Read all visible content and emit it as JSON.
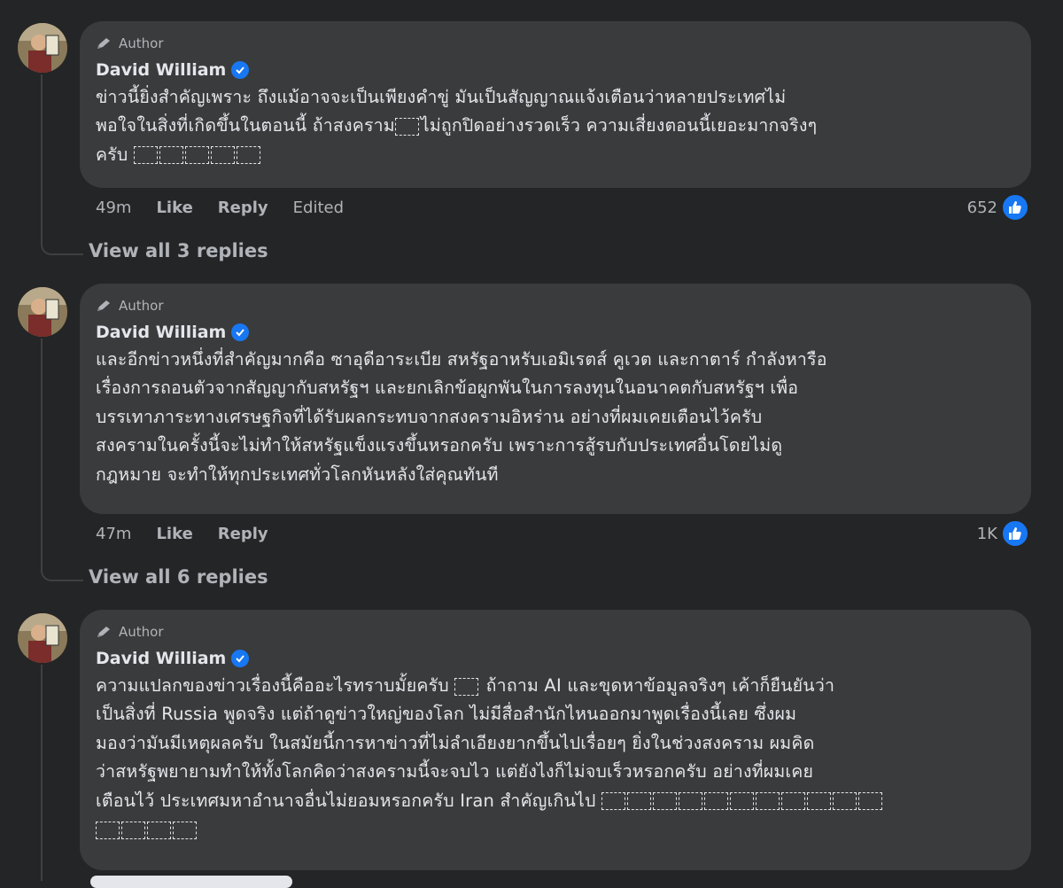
{
  "comments": [
    {
      "badge": "Author",
      "name": "David William",
      "lines": [
        "ข่าวนี้ยิ่งสำคัญเพราะ ถึงแม้อาจจะเป็นเพียงคำขู่ มันเป็นสัญญาณแจ้งเตือนว่าหลายประเทศไม่",
        "พอใจในสิ่งที่เกิดขึ้นในตอนนี้ ถ้าสงคราม",
        "ไม่ถูกปิดอย่างรวดเร็ว ความเสี่ยงตอนนี้เยอะมากจริงๆ",
        "ครับ"
      ],
      "time": "49m",
      "like": "Like",
      "reply": "Reply",
      "edited": "Edited",
      "reactions": "652",
      "view_replies": "View all 3 replies"
    },
    {
      "badge": "Author",
      "name": "David William",
      "lines": [
        "และอีกข่าวหนึ่งที่สำคัญมากคือ ซาอุดีอาระเบีย สหรัฐอาหรับเอมิเรตส์ คูเวต และกาตาร์ กำลังหารือ",
        "เรื่องการถอนตัวจากสัญญากับสหรัฐฯ และยกเลิกข้อผูกพันในการลงทุนในอนาคตกับสหรัฐฯ เพื่อ",
        "บรรเทาภาระทางเศรษฐกิจที่ได้รับผลกระทบจากสงครามอิหร่าน อย่างที่ผมเคยเตือนไว้ครับ",
        "สงครามในครั้งนี้จะไม่ทำให้สหรัฐแข็งแรงขึ้นหรอกครับ เพราะการสู้รบกับประเทศอื่นโดยไม่ดู",
        "กฎหมาย จะทำให้ทุกประเทศทั่วโลกหันหลังใส่คุณทันที"
      ],
      "time": "47m",
      "like": "Like",
      "reply": "Reply",
      "reactions": "1K",
      "view_replies": "View all 6 replies"
    },
    {
      "badge": "Author",
      "name": "David William",
      "lines": [
        "ความแปลกของข่าวเรื่องนี้คืออะไรทราบมั้ยครับ",
        "ถ้าถาม AI และขุดหาข้อมูลจริงๆ เค้าก็ยืนยันว่า",
        "เป็นสิ่งที่ Russia พูดจริง แต่ถ้าดูข่าวใหญ่ของโลก ไม่มีสื่อสำนักไหนออกมาพูดเรื่องนี้เลย ซึ่งผม",
        "มองว่ามันมีเหตุผลครับ ในสมัยนี้การหาข่าวที่ไม่ลำเอียงยากขึ้นไปเรื่อยๆ ยิ่งในช่วงสงคราม ผมคิด",
        "ว่าสหรัฐพยายามทำให้ทั้งโลกคิดว่าสงครามนี้จะจบไว แต่ยังไงก็ไม่จบเร็วหรอกครับ อย่างที่ผมเคย",
        "เตือนไว้ ประเทศมหาอำนาจอื่นไม่ยอมหรอกครับ Iran สำคัญเกินไป"
      ]
    }
  ]
}
